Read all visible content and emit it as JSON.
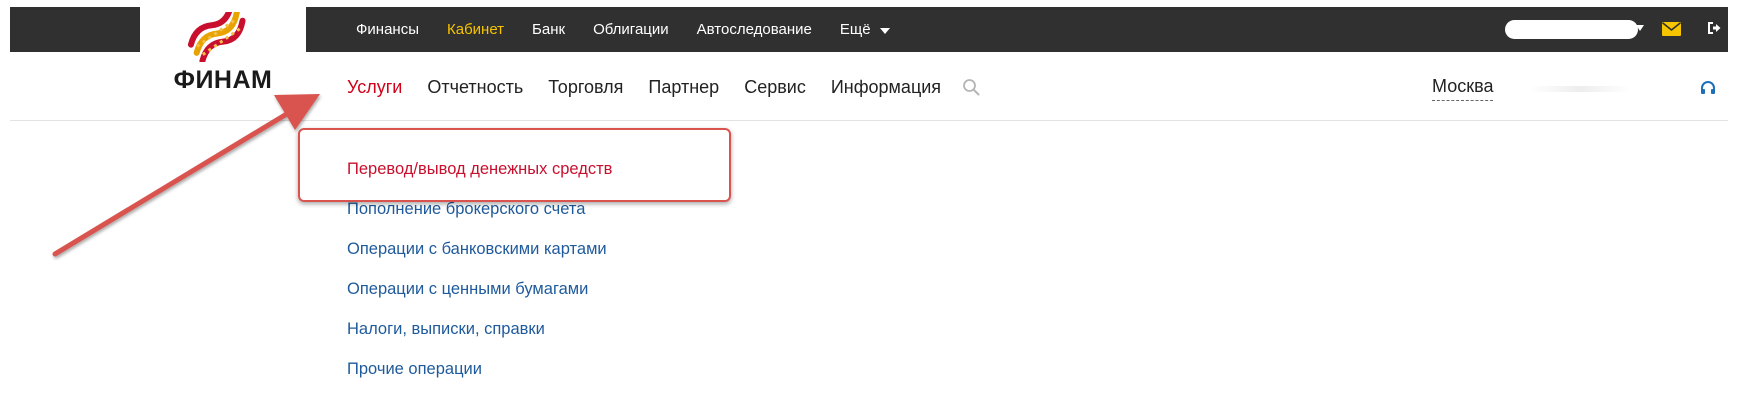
{
  "logo": {
    "text": "ФИНАМ"
  },
  "topnav": {
    "items": [
      {
        "label": "Финансы",
        "active": false
      },
      {
        "label": "Кабинет",
        "active": true
      },
      {
        "label": "Банк",
        "active": false
      },
      {
        "label": "Облигации",
        "active": false
      },
      {
        "label": "Автоследование",
        "active": false
      }
    ],
    "more_label": "Ещё"
  },
  "user_area": {
    "icons": [
      "user-menu",
      "mail-icon",
      "logout-icon"
    ]
  },
  "mainnav": {
    "items": [
      {
        "label": "Услуги",
        "active": true
      },
      {
        "label": "Отчетность",
        "active": false
      },
      {
        "label": "Торговля",
        "active": false
      },
      {
        "label": "Партнер",
        "active": false
      },
      {
        "label": "Сервис",
        "active": false
      },
      {
        "label": "Информация",
        "active": false
      }
    ],
    "city": "Москва"
  },
  "submenu": {
    "items": [
      {
        "label": "Перевод/вывод денежных средств",
        "highlighted": true
      },
      {
        "label": "Пополнение брокерского счета",
        "highlighted": false
      },
      {
        "label": "Операции с банковскими картами",
        "highlighted": false
      },
      {
        "label": "Операции с ценными бумагами",
        "highlighted": false
      },
      {
        "label": "Налоги, выписки, справки",
        "highlighted": false
      },
      {
        "label": "Прочие операции",
        "highlighted": false
      }
    ]
  },
  "colors": {
    "topbar_bg": "#303030",
    "active_top": "#f6c400",
    "active_main": "#d0021b",
    "link": "#1e5a9c",
    "annotation": "#d9534f"
  }
}
